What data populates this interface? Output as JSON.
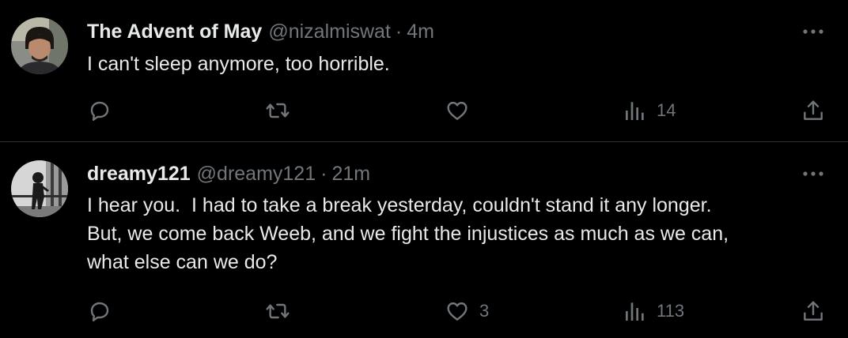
{
  "tweets": [
    {
      "display_name": "The Advent of May",
      "handle": "@nizalmiswat",
      "separator": "·",
      "time": "4m",
      "text_lines": [
        "I can't sleep anymore, too horrible."
      ],
      "likes": "",
      "views": "14",
      "avatar": "person-portrait-photo"
    },
    {
      "display_name": "dreamy121",
      "handle": "@dreamy121",
      "separator": "·",
      "time": "21m",
      "text_lines": [
        "I hear you.  I had to take a break yesterday, couldn't stand it any longer.",
        "But, we come back Weeb, and we fight the injustices as much as we can,",
        "what else can we do?"
      ],
      "likes": "3",
      "views": "113",
      "avatar": "black-and-white-figure-photo"
    }
  ],
  "icons": {
    "reply": "reply-icon",
    "retweet": "retweet-icon",
    "like": "like-icon",
    "views": "views-icon",
    "share": "share-icon",
    "more": "more-icon"
  },
  "colors": {
    "background": "#000000",
    "primary_text": "#e7e9ea",
    "secondary_text": "#71767b",
    "divider": "#2f3336"
  }
}
